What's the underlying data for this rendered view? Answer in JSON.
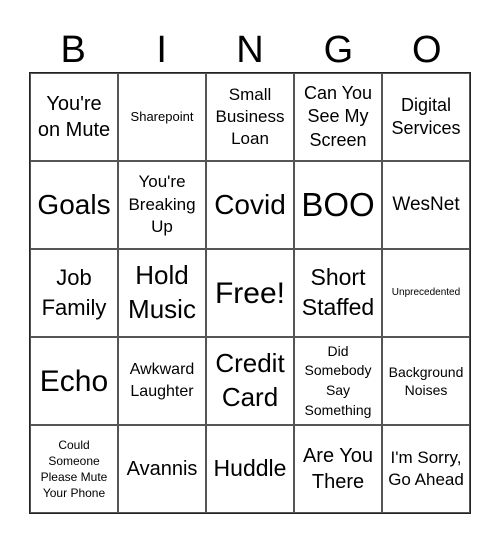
{
  "title_letters": [
    "B",
    "I",
    "N",
    "G",
    "O"
  ],
  "cells": [
    {
      "text": "You're on Mute",
      "size": 20,
      "lh": 1.3
    },
    {
      "text": "Sharepoint",
      "size": 13,
      "lh": 1.2
    },
    {
      "text": "Small Business Loan",
      "size": 17,
      "lh": 1.3
    },
    {
      "text": "Can You See My Screen",
      "size": 18,
      "lh": 1.3
    },
    {
      "text": "Digital Services",
      "size": 18,
      "lh": 1.3
    },
    {
      "text": "Goals",
      "size": 28,
      "lh": 1.1
    },
    {
      "text": "You're Breaking Up",
      "size": 17,
      "lh": 1.35
    },
    {
      "text": "Covid",
      "size": 28,
      "lh": 1.1
    },
    {
      "text": "BOO",
      "size": 33,
      "lh": 1.1
    },
    {
      "text": "WesNet",
      "size": 19,
      "lh": 1.2
    },
    {
      "text": "Job Family",
      "size": 22,
      "lh": 1.35
    },
    {
      "text": "Hold Music",
      "size": 26,
      "lh": 1.3
    },
    {
      "text": "Free!",
      "size": 30,
      "lh": 1.1
    },
    {
      "text": "Short Staffed",
      "size": 23,
      "lh": 1.3
    },
    {
      "text": "Unprecedented",
      "size": 10,
      "lh": 1.2
    },
    {
      "text": "Echo",
      "size": 30,
      "lh": 1.1
    },
    {
      "text": "Awkward Laughter",
      "size": 16,
      "lh": 1.35
    },
    {
      "text": "Credit Card",
      "size": 26,
      "lh": 1.3
    },
    {
      "text": "Did Somebody Say Something",
      "size": 14,
      "lh": 1.4
    },
    {
      "text": "Background Noises",
      "size": 14,
      "lh": 1.3
    },
    {
      "text": "Could Someone Please Mute Your Phone",
      "size": 12,
      "lh": 1.35
    },
    {
      "text": "Avannis",
      "size": 20,
      "lh": 1.2
    },
    {
      "text": "Huddle",
      "size": 23,
      "lh": 1.2
    },
    {
      "text": "Are You There",
      "size": 20,
      "lh": 1.3
    },
    {
      "text": "I'm Sorry, Go Ahead",
      "size": 17,
      "lh": 1.3
    }
  ]
}
